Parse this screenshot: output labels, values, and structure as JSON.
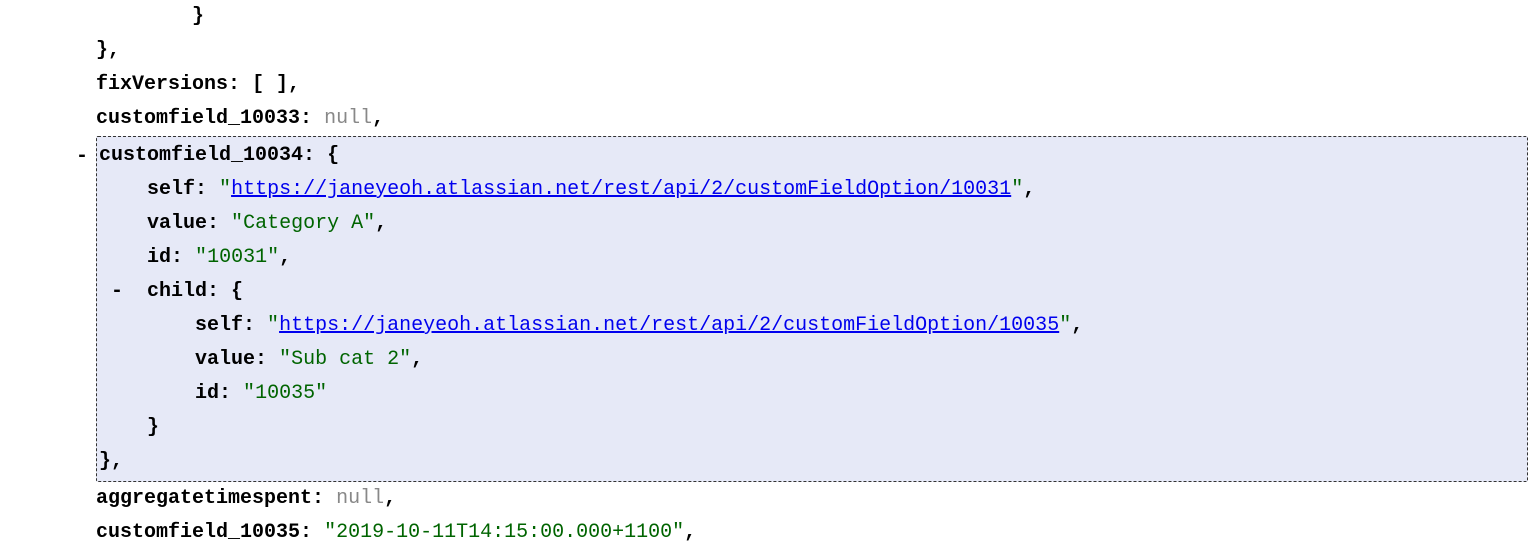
{
  "indent0": "",
  "indent1": "    ",
  "indent2": "        ",
  "indent3": "            ",
  "closeBrace0": "}",
  "closeBrace1Comma": "},",
  "keys": {
    "fixVersions": "fixVersions",
    "customfield_10033": "customfield_10033",
    "customfield_10034": "customfield_10034",
    "self": "self",
    "value": "value",
    "id": "id",
    "child": "child",
    "aggregatetimespent": "aggregatetimespent",
    "customfield_10035": "customfield_10035"
  },
  "punct": {
    "colonSpace": ": ",
    "openBrace": "{",
    "openArrayEmpty": "[ ],",
    "comma": ","
  },
  "vals": {
    "null": "null",
    "selfUrl1": "https://janeyeoh.atlassian.net/rest/api/2/customFieldOption/10031",
    "valueA": "Category A",
    "id10031": "10031",
    "selfUrl2": "https://janeyeoh.atlassian.net/rest/api/2/customFieldOption/10035",
    "valueSub": "Sub cat 2",
    "id10035": "10035",
    "cf10035": "2019-10-11T14:15:00.000+1100"
  },
  "toggle": {
    "minus": "-"
  }
}
